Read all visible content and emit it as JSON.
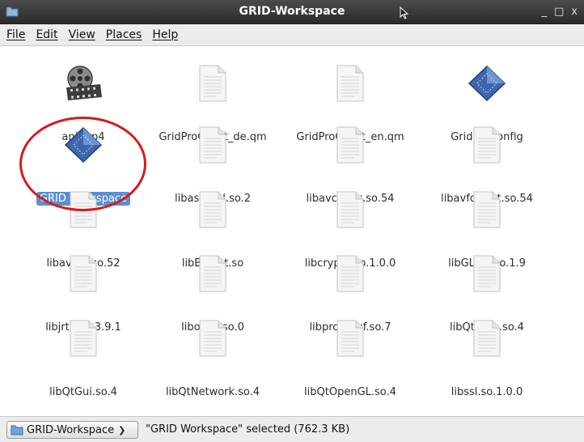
{
  "window": {
    "title": "GRID-Workspace",
    "controls": [
      "_",
      "□",
      "x"
    ]
  },
  "menu": [
    "File",
    "Edit",
    "View",
    "Places",
    "Help"
  ],
  "files": [
    {
      "name": "ani.mp4",
      "icon": "film-reel-icon",
      "selected": false
    },
    {
      "name": "GridProClient_de.qm",
      "icon": "document-icon",
      "selected": false
    },
    {
      "name": "GridProClient_en.qm",
      "icon": "document-icon",
      "selected": false
    },
    {
      "name": "GridProConfig",
      "icon": "executable-diamond-icon",
      "selected": false
    },
    {
      "name": "GRID Workspace",
      "icon": "executable-diamond-icon",
      "selected": true
    },
    {
      "name": "libasound.so.2",
      "icon": "document-icon",
      "selected": false
    },
    {
      "name": "libavcodec.so.54",
      "icon": "document-icon",
      "selected": false
    },
    {
      "name": "libavformat.so.54",
      "icon": "document-icon",
      "selected": false
    },
    {
      "name": "libavutil.so.52",
      "icon": "document-icon",
      "selected": false
    },
    {
      "name": "libBifrost.so",
      "icon": "document-icon",
      "selected": false
    },
    {
      "name": "libcrypto.so.1.0.0",
      "icon": "document-icon",
      "selected": false
    },
    {
      "name": "libGLEW.so.1.9",
      "icon": "document-icon",
      "selected": false
    },
    {
      "name": "libjrtp.so.3.9.1",
      "icon": "document-icon",
      "selected": false
    },
    {
      "name": "libopus.so.0",
      "icon": "document-icon",
      "selected": false
    },
    {
      "name": "libprotobuf.so.7",
      "icon": "document-icon",
      "selected": false
    },
    {
      "name": "libQtCore.so.4",
      "icon": "document-icon",
      "selected": false
    },
    {
      "name": "libQtGui.so.4",
      "icon": "document-icon",
      "selected": false
    },
    {
      "name": "libQtNetwork.so.4",
      "icon": "document-icon",
      "selected": false
    },
    {
      "name": "libQtOpenGL.so.4",
      "icon": "document-icon",
      "selected": false
    },
    {
      "name": "libssl.so.1.0.0",
      "icon": "document-icon",
      "selected": false
    }
  ],
  "status": {
    "location": "GRID-Workspace",
    "message": "\"GRID Workspace\" selected (762.3 KB)"
  },
  "colors": {
    "selection": "#5b8fd1",
    "annotation": "#d21d1d",
    "titlebar": "#333333"
  }
}
